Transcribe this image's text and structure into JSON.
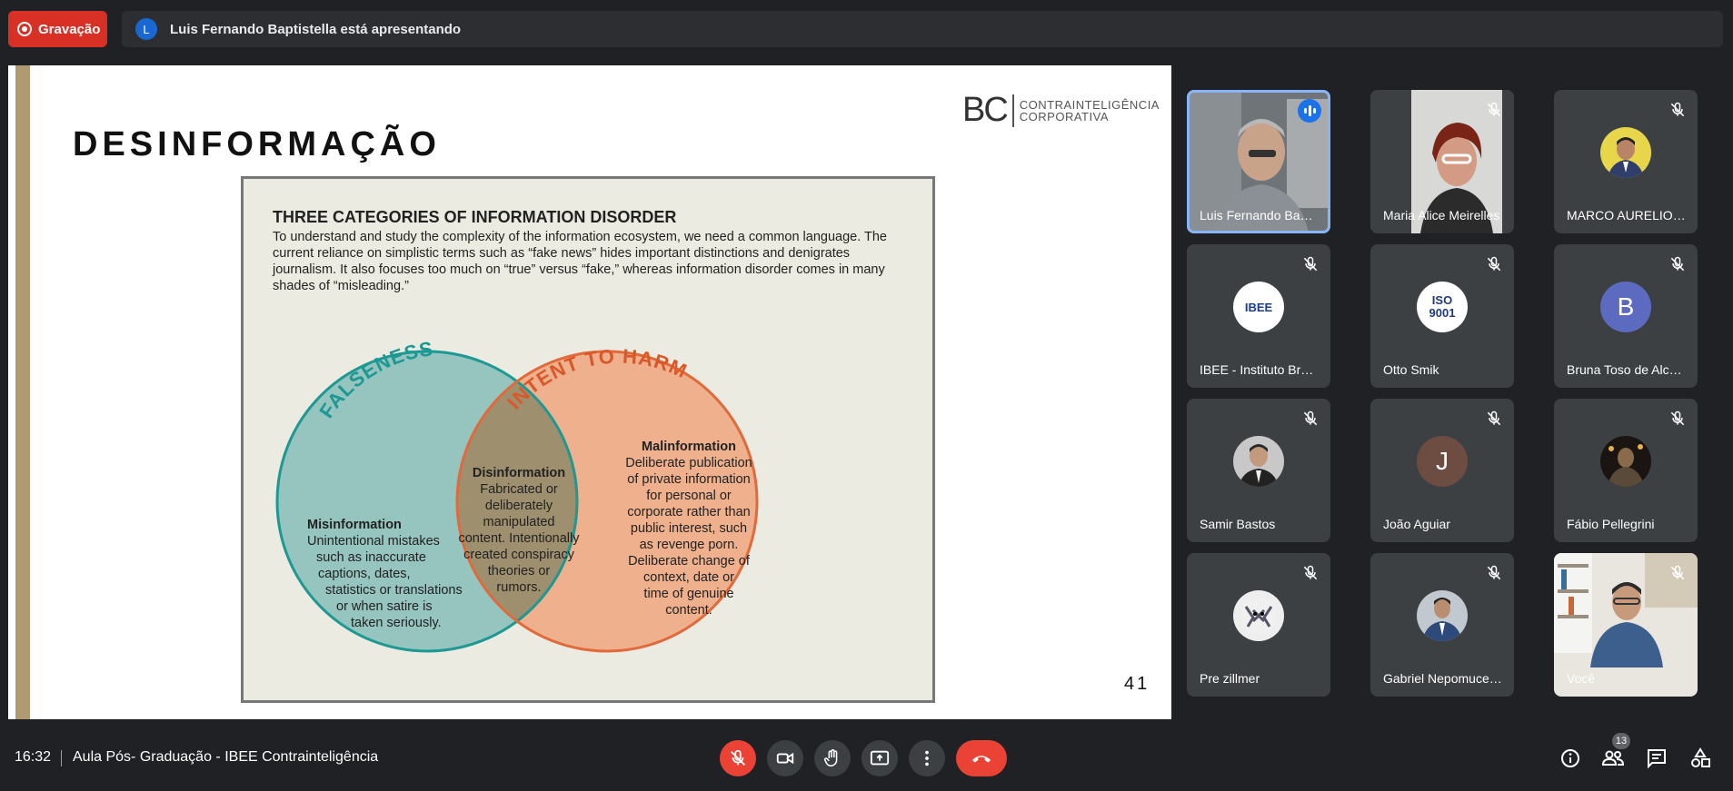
{
  "recording": {
    "label": "Gravação"
  },
  "presenter_banner": {
    "avatar_letter": "L",
    "text": "Luis Fernando Baptistella está apresentando"
  },
  "slide": {
    "title": "DESINFORMAÇÃO",
    "logo_letters": "BC",
    "logo_line1": "CONTRAINTELIGÊNCIA",
    "logo_line2": "CORPORATIVA",
    "page_number": "41",
    "figure": {
      "heading": "THREE CATEGORIES OF INFORMATION DISORDER",
      "intro": "To understand and study the complexity of the information ecosystem, we need a common language. The current reliance on simplistic terms such as “fake news” hides important distinctions and denigrates journalism. It also focuses too much on “true” versus “fake,” whereas information disorder comes in many shades of “misleading.”",
      "left_arc": "FALSENESS",
      "right_arc": "INTENT TO HARM",
      "misinformation": {
        "title": "Misinformation",
        "l1": "Unintentional mistakes",
        "l2": "such as inaccurate",
        "l3": "captions, dates,",
        "l4": "statistics or translations",
        "l5": "or when satire is",
        "l6": "taken seriously."
      },
      "disinformation": {
        "title": "Disinformation",
        "l1": "Fabricated or",
        "l2": "deliberately manipulated",
        "l3": "content. Intentionally",
        "l4": "created conspiracy",
        "l5": "theories or",
        "l6": "rumors."
      },
      "malinformation": {
        "title": "Malinformation",
        "l1": "Deliberate publication",
        "l2": "of private information",
        "l3": "for personal or",
        "l4": "corporate rather than",
        "l5": "public interest, such",
        "l6": "as revenge porn.",
        "l7": "Deliberate change of",
        "l8": "context, date or",
        "l9": "time of genuine",
        "l10": "content."
      },
      "colors": {
        "left": "#96c4bf",
        "right": "#eeb08d",
        "overlap": "#9e8f6e",
        "left_stroke": "#1d9892",
        "right_stroke": "#e06a3b"
      }
    }
  },
  "participants": [
    {
      "name": "Luis Fernando Baptist...",
      "type": "video",
      "speaking": true
    },
    {
      "name": "Maria Alice Meirelles",
      "type": "video"
    },
    {
      "name": "MARCO AURELIO MO...",
      "type": "photo"
    },
    {
      "name": "IBEE - Instituto Brasile...",
      "type": "photo",
      "avatar_text": "IBEE"
    },
    {
      "name": "Otto Smik",
      "type": "photo",
      "avatar_text": "ISO 9001"
    },
    {
      "name": "Bruna Toso de Alcânt...",
      "type": "letter",
      "avatar_text": "B",
      "color": "#5c6bc0"
    },
    {
      "name": "Samir Bastos",
      "type": "photo"
    },
    {
      "name": "João Aguiar",
      "type": "letter",
      "avatar_text": "J",
      "color": "#6d4c41"
    },
    {
      "name": "Fábio Pellegrini",
      "type": "photo"
    },
    {
      "name": "Pre zillmer",
      "type": "photo"
    },
    {
      "name": "Gabriel Nepomuceno",
      "type": "photo"
    },
    {
      "name": "Você",
      "type": "video"
    }
  ],
  "bottom": {
    "time": "16:32",
    "meeting_title": "Aula Pós- Graduação - IBEE Contrainteligência",
    "participant_count": "13",
    "icons": [
      "mic-off-icon",
      "camera-icon",
      "raise-hand-icon",
      "present-icon",
      "more-icon",
      "end-call-icon",
      "info-icon",
      "people-icon",
      "chat-icon",
      "activities-icon"
    ]
  }
}
